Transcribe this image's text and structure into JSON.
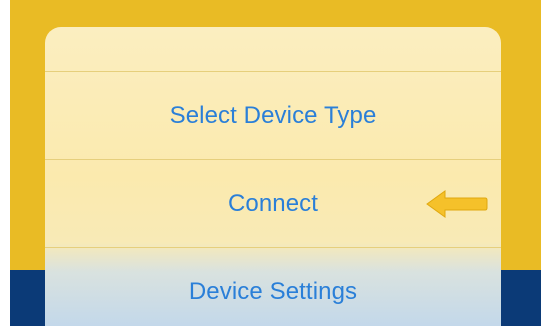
{
  "action_sheet": {
    "items": [
      {
        "label": "Select Device Type"
      },
      {
        "label": "Connect"
      },
      {
        "label": "Device Settings"
      }
    ]
  },
  "annotation": {
    "icon": "left-arrow-icon",
    "color": "#f5c12a"
  },
  "colors": {
    "background_top": "#e9bb25",
    "background_bottom": "#0b3a77",
    "action_text": "#2a7fd8"
  }
}
